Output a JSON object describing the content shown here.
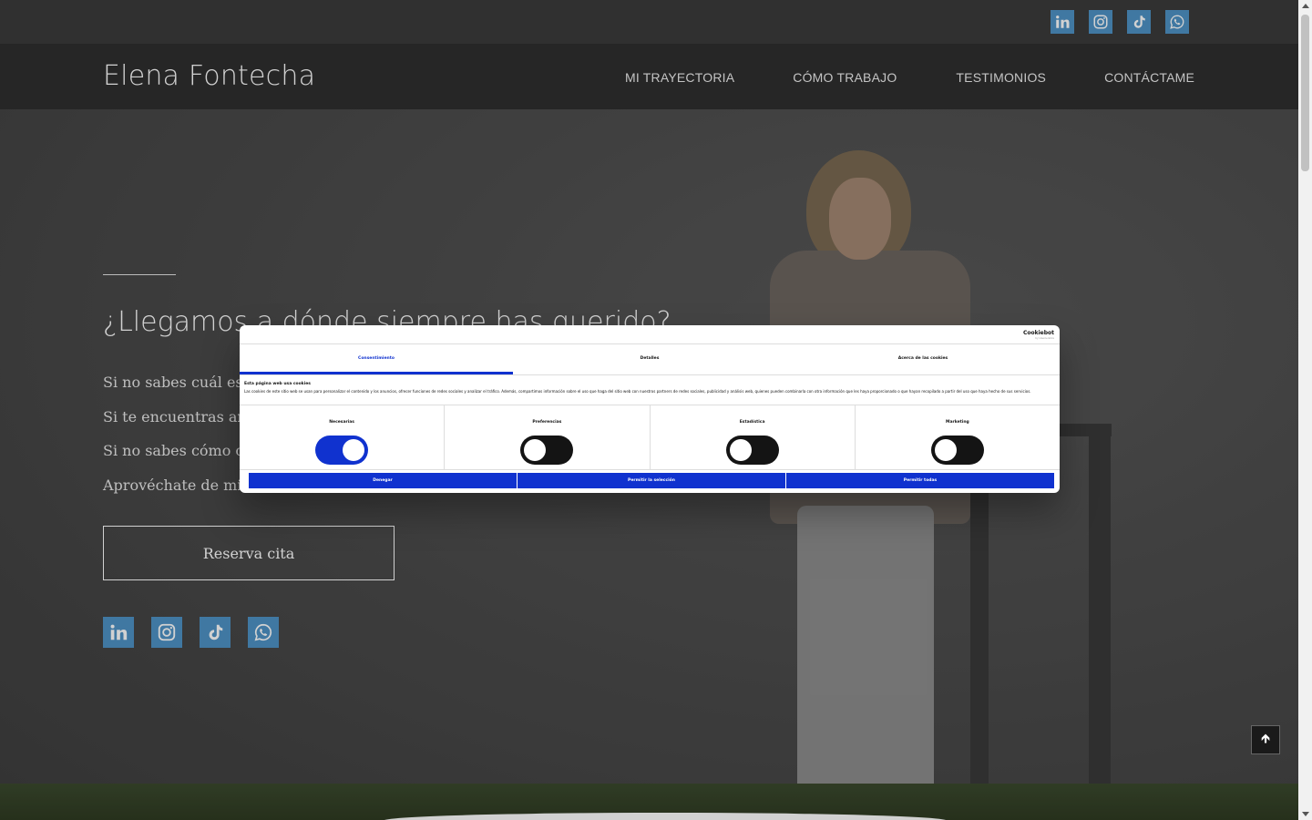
{
  "header": {
    "logo": "Elena Fontecha",
    "nav": [
      "MI TRAYECTORIA",
      "CÓMO TRABAJO",
      "TESTIMONIOS",
      "CONTÁCTAME"
    ]
  },
  "social_icons": [
    "linkedin-icon",
    "instagram-icon",
    "tiktok-icon",
    "whatsapp-icon"
  ],
  "hero": {
    "title": "¿Llegamos a dónde siempre has querido?",
    "lines": [
      "Si no sabes cuál es el",
      "Si te encuentras ante",
      "Si no sabes cómo con",
      "Aprovéchate de mi ex"
    ],
    "cta": "Reserva cita"
  },
  "cookie": {
    "brand": "Cookiebot",
    "brand_sub": "by Usercentrics",
    "tabs": [
      "Consentimiento",
      "Detalles",
      "Acerca de las cookies"
    ],
    "active_tab": 0,
    "title": "Esta página web usa cookies",
    "description": "Las cookies de este sitio web se usan para personalizar el contenido y los anuncios, ofrecer funciones de redes sociales y analizar el tráfico. Además, compartimos información sobre el uso que haga del sitio web con nuestros partners de redes sociales, publicidad y análisis web, quienes pueden combinarla con otra información que les haya proporcionado o que hayan recopilado a partir del uso que haya hecho de sus servicios.",
    "categories": [
      {
        "label": "Necesarias",
        "on": true
      },
      {
        "label": "Preferencias",
        "on": false
      },
      {
        "label": "Estadística",
        "on": false
      },
      {
        "label": "Marketing",
        "on": false
      }
    ],
    "buttons": [
      "Denegar",
      "Permitir la selección",
      "Permitir todas"
    ]
  },
  "colors": {
    "accent": "#1032cf",
    "social": "#4f93c6",
    "header_bg": "#2f2f2f"
  }
}
